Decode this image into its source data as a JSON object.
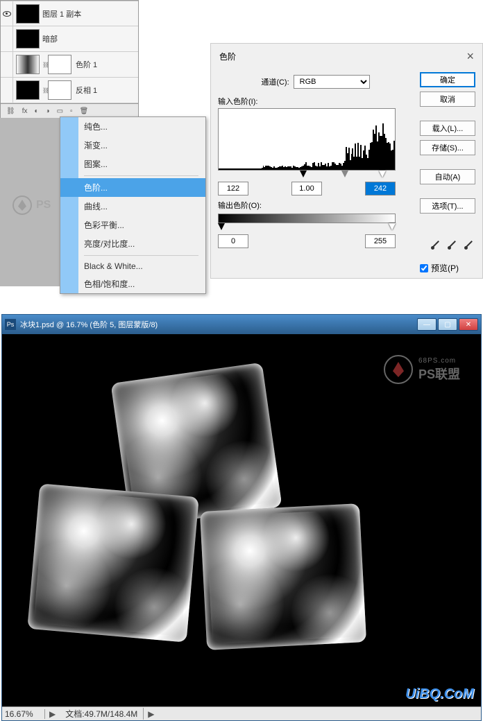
{
  "layers": {
    "items": [
      {
        "name": "图层 1 副本",
        "visible": true,
        "thumb": "ice"
      },
      {
        "name": "暗部",
        "visible": false,
        "thumb": "dark"
      },
      {
        "name": "色阶 1",
        "visible": false,
        "thumb": "adj",
        "linked": true,
        "mask": true
      },
      {
        "name": "反相 1",
        "visible": false,
        "thumb": "adj2",
        "linked": true,
        "mask": true
      }
    ]
  },
  "context_menu": {
    "items": [
      {
        "label": "纯色...",
        "highlighted": false
      },
      {
        "label": "渐变...",
        "highlighted": false
      },
      {
        "label": "图案...",
        "highlighted": false
      },
      {
        "sep": true
      },
      {
        "label": "色阶...",
        "highlighted": true
      },
      {
        "label": "曲线...",
        "highlighted": false
      },
      {
        "label": "色彩平衡...",
        "highlighted": false
      },
      {
        "label": "亮度/对比度...",
        "highlighted": false
      },
      {
        "sep": true
      },
      {
        "label": "Black & White...",
        "highlighted": false
      },
      {
        "label": "色相/饱和度...",
        "highlighted": false
      }
    ]
  },
  "levels_dialog": {
    "title": "色阶",
    "channel_label": "通道(C):",
    "channel_value": "RGB",
    "input_label": "输入色阶(I):",
    "output_label": "输出色阶(O):",
    "input_low": "122",
    "input_mid": "1.00",
    "input_high": "242",
    "output_low": "0",
    "output_high": "255",
    "buttons": {
      "ok": "确定",
      "cancel": "取消",
      "load": "载入(L)...",
      "save": "存储(S)...",
      "auto": "自动(A)",
      "options": "选项(T)..."
    },
    "preview_label": "预览(P)",
    "preview_checked": true
  },
  "doc_window": {
    "title": "冰块1.psd @ 16.7% (色阶 5, 图层蒙版/8)",
    "zoom": "16.67%",
    "docsize_label": "文档:",
    "docsize_value": "49.7M/148.4M"
  },
  "watermark_ps": {
    "small": "68PS.com",
    "large": "PS联盟"
  },
  "watermark_uibq": "UiBQ.CoM"
}
